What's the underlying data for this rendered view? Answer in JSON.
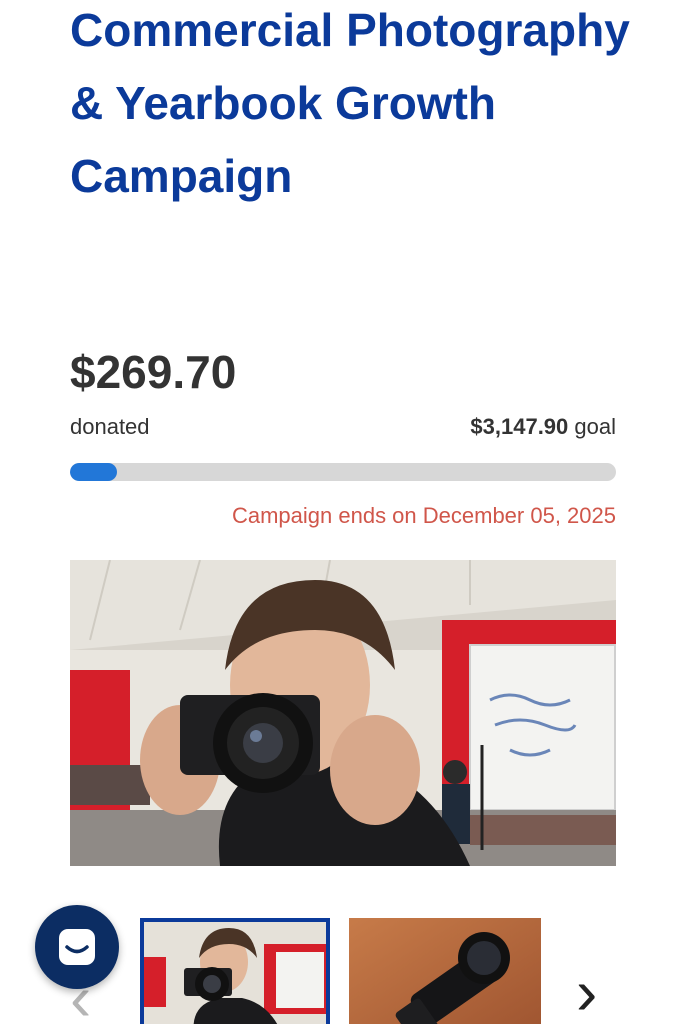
{
  "campaign": {
    "title": "Commercial Photography & Yearbook Growth Campaign",
    "amount_raised": "$269.70",
    "donated_label": "donated",
    "goal_amount": "$3,147.90",
    "goal_label": "goal",
    "progress_fraction": 0.0857,
    "end_notice": "Campaign ends on December 05, 2025"
  },
  "gallery": {
    "main_photo_alt": "Student holding a camera up to their face in a classroom",
    "thumbnails": [
      {
        "alt": "Student holding a camera",
        "selected": true
      },
      {
        "alt": "Camera with large lens on a wooden table",
        "selected": false
      }
    ],
    "prev_icon": "chevron-left-icon",
    "next_icon": "chevron-right-icon"
  },
  "chat": {
    "icon": "chat-icon"
  },
  "colors": {
    "title": "#0b3a9a",
    "progress_fill": "#2277d8",
    "progress_track": "#d7d7d7",
    "end_notice": "#d0564a",
    "chat_button": "#0c2d63"
  }
}
